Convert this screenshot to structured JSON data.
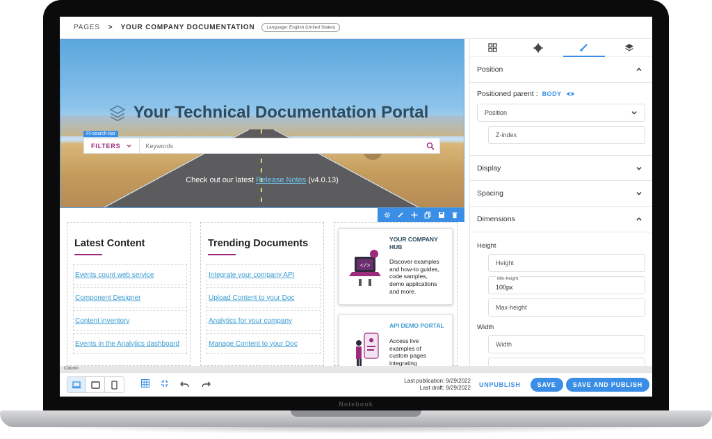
{
  "device": {
    "model": "Notebook"
  },
  "breadcrumb": {
    "pages": "PAGES",
    "separator": ">",
    "current": "YOUR COMPANY DOCUMENTATION",
    "language": "Language: English (United States)"
  },
  "hero": {
    "title": "Your Technical Documentation Portal",
    "component_tag": "Ft-search-bar",
    "filters_label": "FILTERS",
    "search_placeholder": "Keywords",
    "release_prefix": "Check out our latest",
    "release_link": "Release Notes",
    "release_version": "(v4.0.13)"
  },
  "columns": {
    "latest": {
      "title": "Latest Content",
      "links": [
        "Events count web service",
        "Component Designer",
        "Content inventory",
        "Events in the Analytics dashboard"
      ]
    },
    "trending": {
      "title": "Trending Documents",
      "links": [
        "Integrate your company API",
        "Upload Content to your Doc",
        "Analytics for your company",
        "Manage Content to your Doc"
      ]
    },
    "cards": [
      {
        "title_line1": "YOUR COMPANY",
        "title_line2": "HUB",
        "desc_lines": [
          "Discover examples",
          "and how-to guides,",
          "code samples,",
          "demo applications",
          "and more."
        ]
      },
      {
        "title_line1": "API DEMO PORTAL",
        "title_line2": "",
        "desc_lines": [
          "Access live",
          "examples of",
          "custom pages",
          "integrating"
        ]
      }
    ]
  },
  "panel": {
    "sections": {
      "position": "Position",
      "display": "Display",
      "spacing": "Spacing",
      "dimensions": "Dimensions"
    },
    "positioned_parent_label": "Positioned parent :",
    "positioned_parent_value": "BODY",
    "position_select": "Position",
    "z_index": "Z-index",
    "height_label": "Height",
    "height_placeholder": "Height",
    "min_height_label": "Min-height",
    "min_height_value": "100px",
    "max_height_placeholder": "Max-height",
    "width_label": "Width",
    "width_placeholder": "Width"
  },
  "status": {
    "element": "Column"
  },
  "footer": {
    "last_publication": "Last publication: 9/29/2022",
    "last_draft": "Last draft: 9/29/2022",
    "unpublish": "UNPUBLISH",
    "save": "SAVE",
    "save_publish": "SAVE AND PUBLISH"
  },
  "colors": {
    "accent": "#3a8ee6",
    "brand_purple": "#9c2b7c",
    "link": "#3a9bd1"
  },
  "icons": [
    "grid-icon",
    "gear-icon",
    "brush-icon",
    "layers-icon",
    "search-icon",
    "chevron-down-icon",
    "eye-icon",
    "laptop-icon",
    "tablet-icon",
    "phone-icon",
    "undo-icon",
    "redo-icon"
  ]
}
